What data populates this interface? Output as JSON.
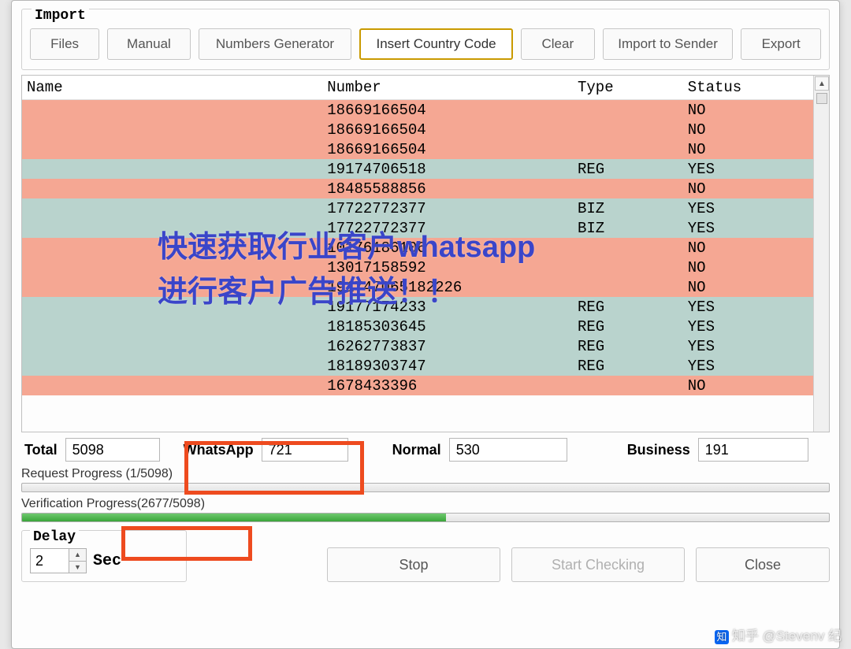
{
  "import": {
    "title": "Import",
    "buttons": {
      "files": "Files",
      "manual": "Manual",
      "numbers_generator": "Numbers Generator",
      "insert_country_code": "Insert Country Code",
      "clear": "Clear",
      "import_to_sender": "Import to Sender",
      "export": "Export"
    }
  },
  "table": {
    "headers": {
      "name": "Name",
      "number": "Number",
      "type": "Type",
      "status": "Status"
    },
    "rows": [
      {
        "name": "",
        "number": "18669166504",
        "type": "",
        "status": "NO",
        "cls": "no"
      },
      {
        "name": "",
        "number": "18669166504",
        "type": "",
        "status": "NO",
        "cls": "no"
      },
      {
        "name": "",
        "number": "18669166504",
        "type": "",
        "status": "NO",
        "cls": "no"
      },
      {
        "name": "",
        "number": "19174706518",
        "type": "REG",
        "status": "YES",
        "cls": "yes"
      },
      {
        "name": "",
        "number": "18485588856",
        "type": "",
        "status": "NO",
        "cls": "no"
      },
      {
        "name": "",
        "number": "17722772377",
        "type": "BIZ",
        "status": "YES",
        "cls": "yes"
      },
      {
        "name": "",
        "number": "17722772377",
        "type": "BIZ",
        "status": "YES",
        "cls": "yes"
      },
      {
        "name": "",
        "number": "10176186106",
        "type": "",
        "status": "NO",
        "cls": "no"
      },
      {
        "name": "",
        "number": "13017158592",
        "type": "",
        "status": "NO",
        "cls": "no"
      },
      {
        "name": "",
        "number": "191747065182226",
        "type": "",
        "status": "NO",
        "cls": "no"
      },
      {
        "name": "",
        "number": "19177174233",
        "type": "REG",
        "status": "YES",
        "cls": "yes"
      },
      {
        "name": "",
        "number": "18185303645",
        "type": "REG",
        "status": "YES",
        "cls": "yes"
      },
      {
        "name": "",
        "number": "16262773837",
        "type": "REG",
        "status": "YES",
        "cls": "yes"
      },
      {
        "name": "",
        "number": "18189303747",
        "type": "REG",
        "status": "YES",
        "cls": "yes"
      },
      {
        "name": "",
        "number": "1678433396",
        "type": "",
        "status": "NO",
        "cls": "no"
      }
    ]
  },
  "stats": {
    "total_label": "Total",
    "total_value": "5098",
    "whatsapp_label": "WhatsApp",
    "whatsapp_value": "721",
    "normal_label": "Normal",
    "normal_value": "530",
    "business_label": "Business",
    "business_value": "191"
  },
  "progress": {
    "request_label": "Request Progress (1/5098)",
    "request_pct": 0.02,
    "verification_label": "Verification Progress(2677/5098)",
    "verification_pct": 52.5
  },
  "delay": {
    "title": "Delay",
    "value": "2",
    "unit": "Sec"
  },
  "bottom": {
    "stop": "Stop",
    "start_checking": "Start Checking",
    "close": "Close"
  },
  "overlay": {
    "line1": "快速获取行业客户whatsapp",
    "line2": "进行客户广告推送！！"
  },
  "watermark": "知乎 @Stevenv 纪"
}
